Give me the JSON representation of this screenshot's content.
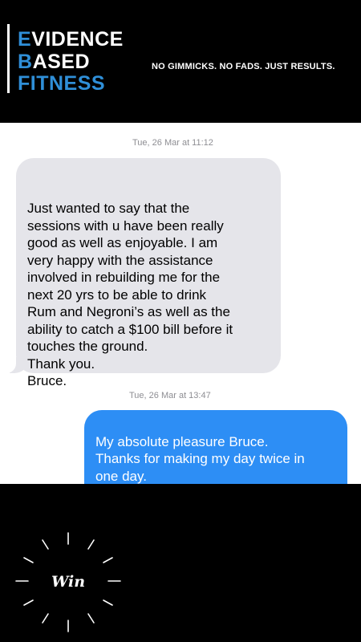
{
  "brand": {
    "line1_first": "E",
    "line1_rest": "VIDENCE",
    "line2_first": "B",
    "line2_rest": "ASED",
    "line3": "FITNESS",
    "tagline": "NO GIMMICKS. NO FADS. JUST RESULTS.",
    "accent_color": "#2f8fd8"
  },
  "messages": [
    {
      "timestamp": "Tue, 26 Mar at 11:12",
      "direction": "incoming",
      "text": "Just wanted to say that the\nsessions with u have been really\ngood as well as enjoyable.  I am\nvery happy with the assistance\ninvolved in rebuilding me for the\nnext 20 yrs to be able to drink\nRum and Negroni’s as well as the\nability to catch a $100 bill before it\ntouches the ground.\nThank you.\nBruce."
    },
    {
      "timestamp": "Tue, 26 Mar at 13:47",
      "direction": "outgoing",
      "text": "My absolute pleasure Bruce.\nThanks for making my day twice in\none day.\nLooking forward to having a"
    }
  ],
  "badge": {
    "label": "Win",
    "icon": "sunburst-icon"
  },
  "colors": {
    "incoming_bubble": "#e5e5ea",
    "outgoing_bubble": "#2d8ef5"
  }
}
